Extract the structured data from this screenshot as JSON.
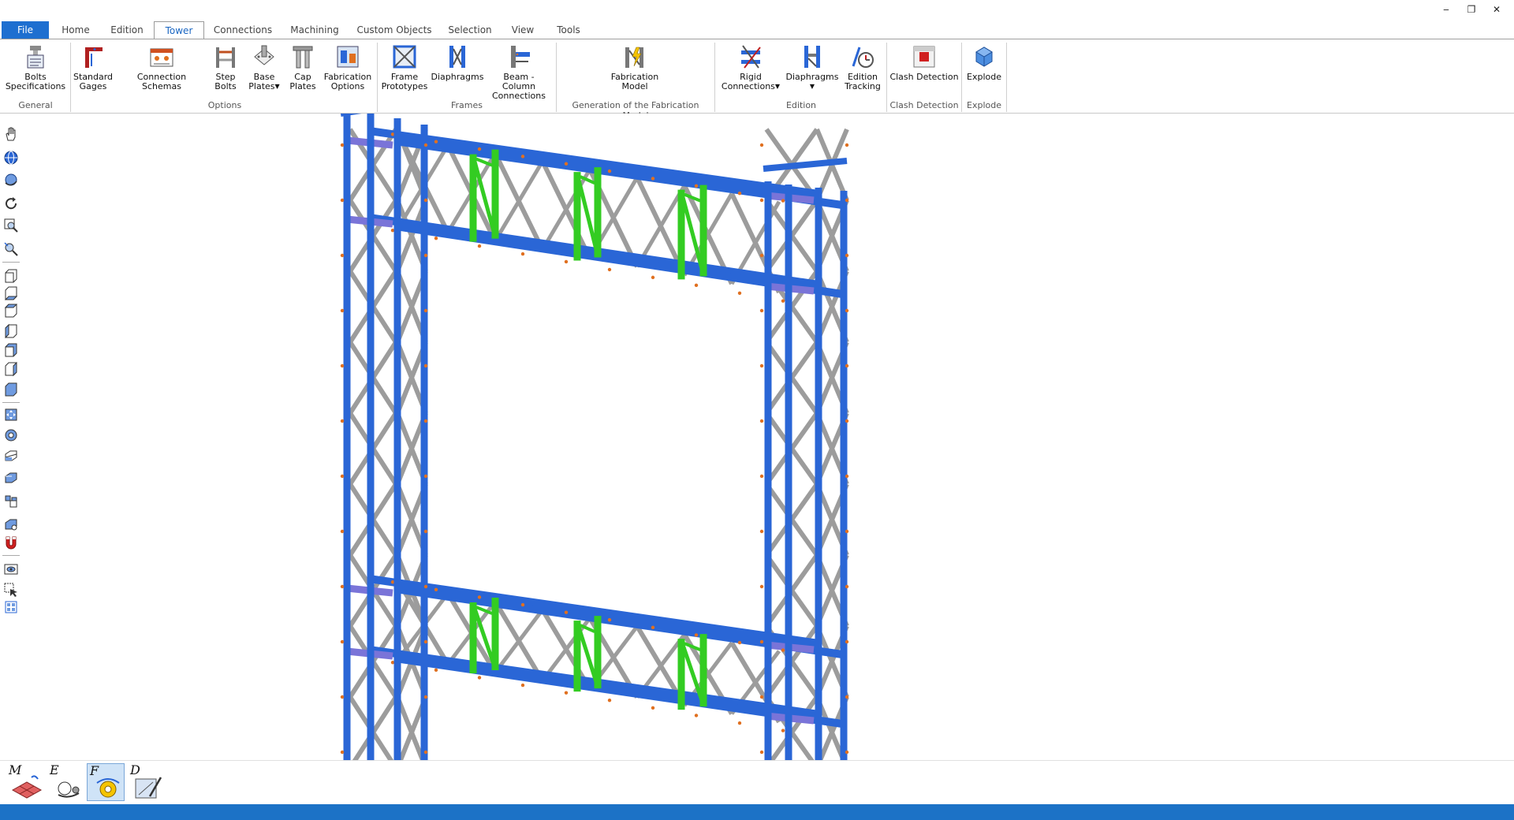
{
  "tabs": {
    "file": "File",
    "home": "Home",
    "edition": "Edition",
    "tower": "Tower",
    "connections": "Connections",
    "machining": "Machining",
    "custom_objects": "Custom Objects",
    "selection": "Selection",
    "view": "View",
    "tools": "Tools",
    "active": "Tower"
  },
  "window_controls": {
    "minimize": "‒",
    "restore": "❐",
    "close": "✕"
  },
  "ribbon": {
    "general": {
      "group": "General",
      "bolts_specifications": "Bolts\nSpecifications"
    },
    "options": {
      "group": "Options",
      "standard_gages": "Standard\nGages",
      "connection_schemas": "Connection Schemas",
      "step_bolts": "Step\nBolts",
      "base_plates": "Base\nPlates",
      "cap_plates": "Cap\nPlates",
      "fabrication_options": "Fabrication\nOptions"
    },
    "frames": {
      "group": "Frames",
      "frame_prototypes": "Frame\nPrototypes",
      "diaphragms": "Diaphragms",
      "beam_column_connections": "Beam - Column\nConnections"
    },
    "generation": {
      "group": "Generation of the Fabrication Model",
      "fabrication_model": "Fabrication\nModel"
    },
    "edition": {
      "group": "Edition",
      "rigid_connections": "Rigid\nConnections",
      "diaphragms": "Diaphragms",
      "edition_tracking": "Edition\nTracking"
    },
    "clash": {
      "group": "Clash Detection",
      "clash_detection": "Clash Detection"
    },
    "explode": {
      "group": "Explode",
      "explode": "Explode"
    }
  },
  "icons": {
    "left_toolbar": [
      "pan-hand-icon",
      "globe-icon",
      "orbit-icon",
      "rotate-icon",
      "zoom-window-icon",
      "zoom-icon",
      "view-front-icon",
      "view-back-icon",
      "view-left-icon",
      "view-right-icon",
      "view-top-icon",
      "view-bottom-icon",
      "view-iso-icon",
      "fit-all-icon",
      "render-mode-icon",
      "section-box-icon",
      "clip-plane-icon",
      "member-filter-icon",
      "layer-visibility-icon",
      "magnet-snap-icon",
      "eye-view-icon",
      "select-cursor-icon",
      "grid-select-icon"
    ]
  },
  "modes": [
    {
      "letter": "M",
      "name": "modeling-mode"
    },
    {
      "letter": "E",
      "name": "engineering-mode"
    },
    {
      "letter": "F",
      "name": "fabrication-mode"
    },
    {
      "letter": "D",
      "name": "drawing-mode"
    }
  ],
  "colors": {
    "accent_blue": "#1e6fd0",
    "column_blue": "#2a66d6",
    "bracing_gray": "#9c9c9c",
    "diaphragm_green": "#33cc22",
    "plate_purple": "#7a74d8",
    "bolt_orange": "#e07020",
    "statusbar": "#1c72c6"
  }
}
